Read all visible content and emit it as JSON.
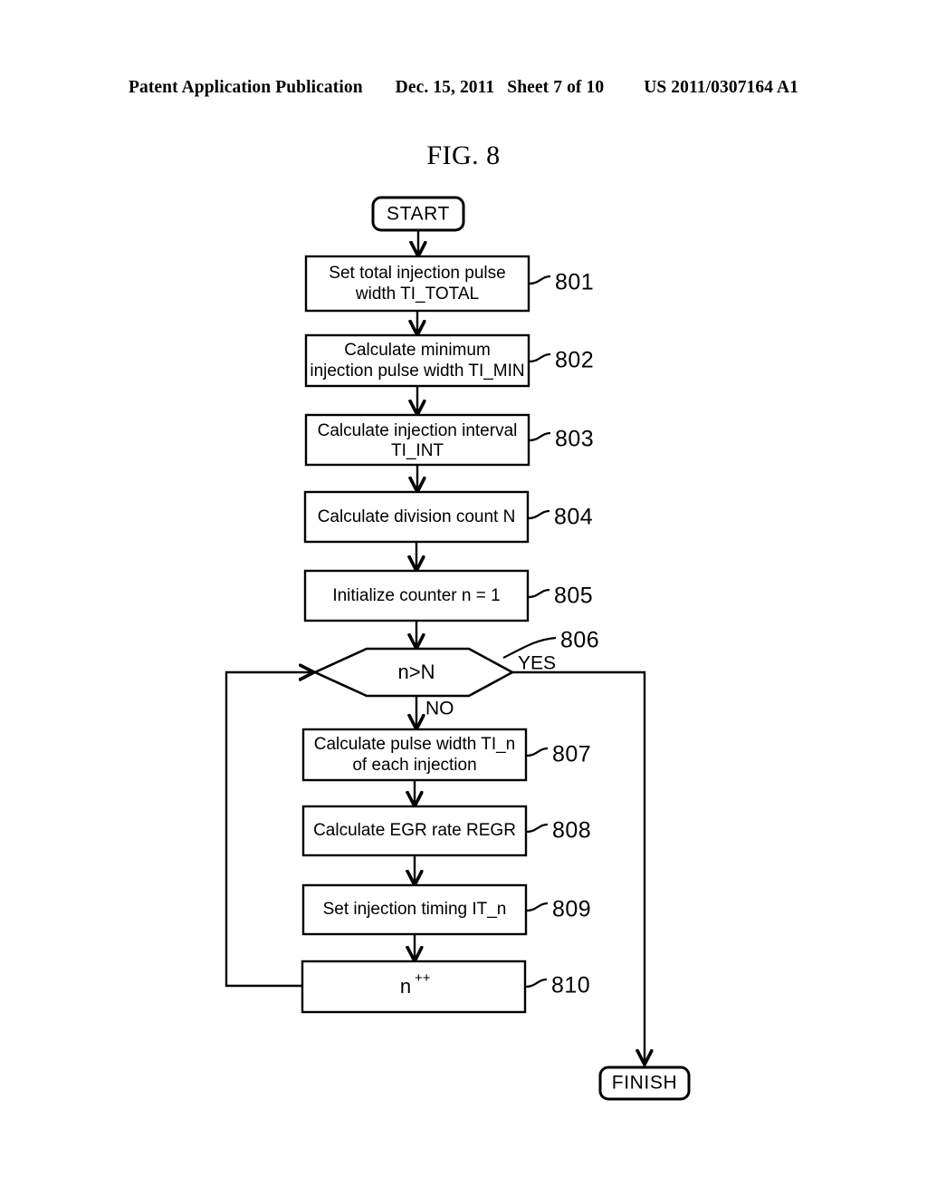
{
  "header": {
    "publication": "Patent Application Publication",
    "date": "Dec. 15, 2011",
    "sheet": "Sheet 7 of 10",
    "number": "US 2011/0307164 A1"
  },
  "figure": {
    "title": "FIG. 8"
  },
  "flowchart": {
    "start_label": "START",
    "finish_label": "FINISH",
    "branch_yes": "YES",
    "branch_no": "NO",
    "steps": [
      {
        "ref": "801",
        "line1": "Set total injection pulse",
        "line2": "width TI_TOTAL"
      },
      {
        "ref": "802",
        "line1": "Calculate minimum",
        "line2": "injection pulse width TI_MIN"
      },
      {
        "ref": "803",
        "line1": "Calculate injection interval",
        "line2": "TI_INT"
      },
      {
        "ref": "804",
        "line1": "Calculate division count N",
        "line2": ""
      },
      {
        "ref": "805",
        "line1": "Initialize counter n = 1",
        "line2": ""
      },
      {
        "ref": "807",
        "line1": "Calculate pulse width TI_n",
        "line2": "of each injection"
      },
      {
        "ref": "808",
        "line1": "Calculate EGR rate REGR",
        "line2": ""
      },
      {
        "ref": "809",
        "line1": "Set injection timing IT_n",
        "line2": ""
      },
      {
        "ref": "810",
        "line1": "n",
        "line2": "++"
      }
    ],
    "decision": {
      "ref": "806",
      "condition": "n>N"
    }
  }
}
